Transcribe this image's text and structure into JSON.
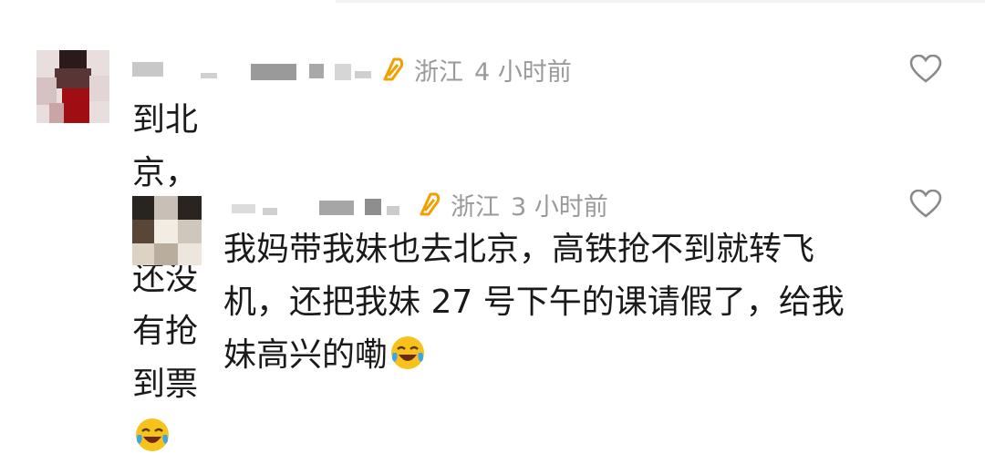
{
  "comments": [
    {
      "location": "浙江",
      "time": "4 小时前",
      "text": "到北京，目前还没有抢到票",
      "emoji": "crying-laughing-emoji"
    },
    {
      "location": "浙江",
      "time": "3 小时前",
      "lines": [
        "我妈带我妹也去北京，高铁抢不到就转飞",
        "机，还把我妹 27 号下午的课请假了，给我",
        "妹高兴的嘞"
      ],
      "emoji": "crying-laughing-emoji"
    }
  ],
  "colors": {
    "location_icon": "#f0a000",
    "meta_text": "#9a9a9a",
    "body_text": "#1a1a1a",
    "like_icon": "#8a8a8a"
  }
}
